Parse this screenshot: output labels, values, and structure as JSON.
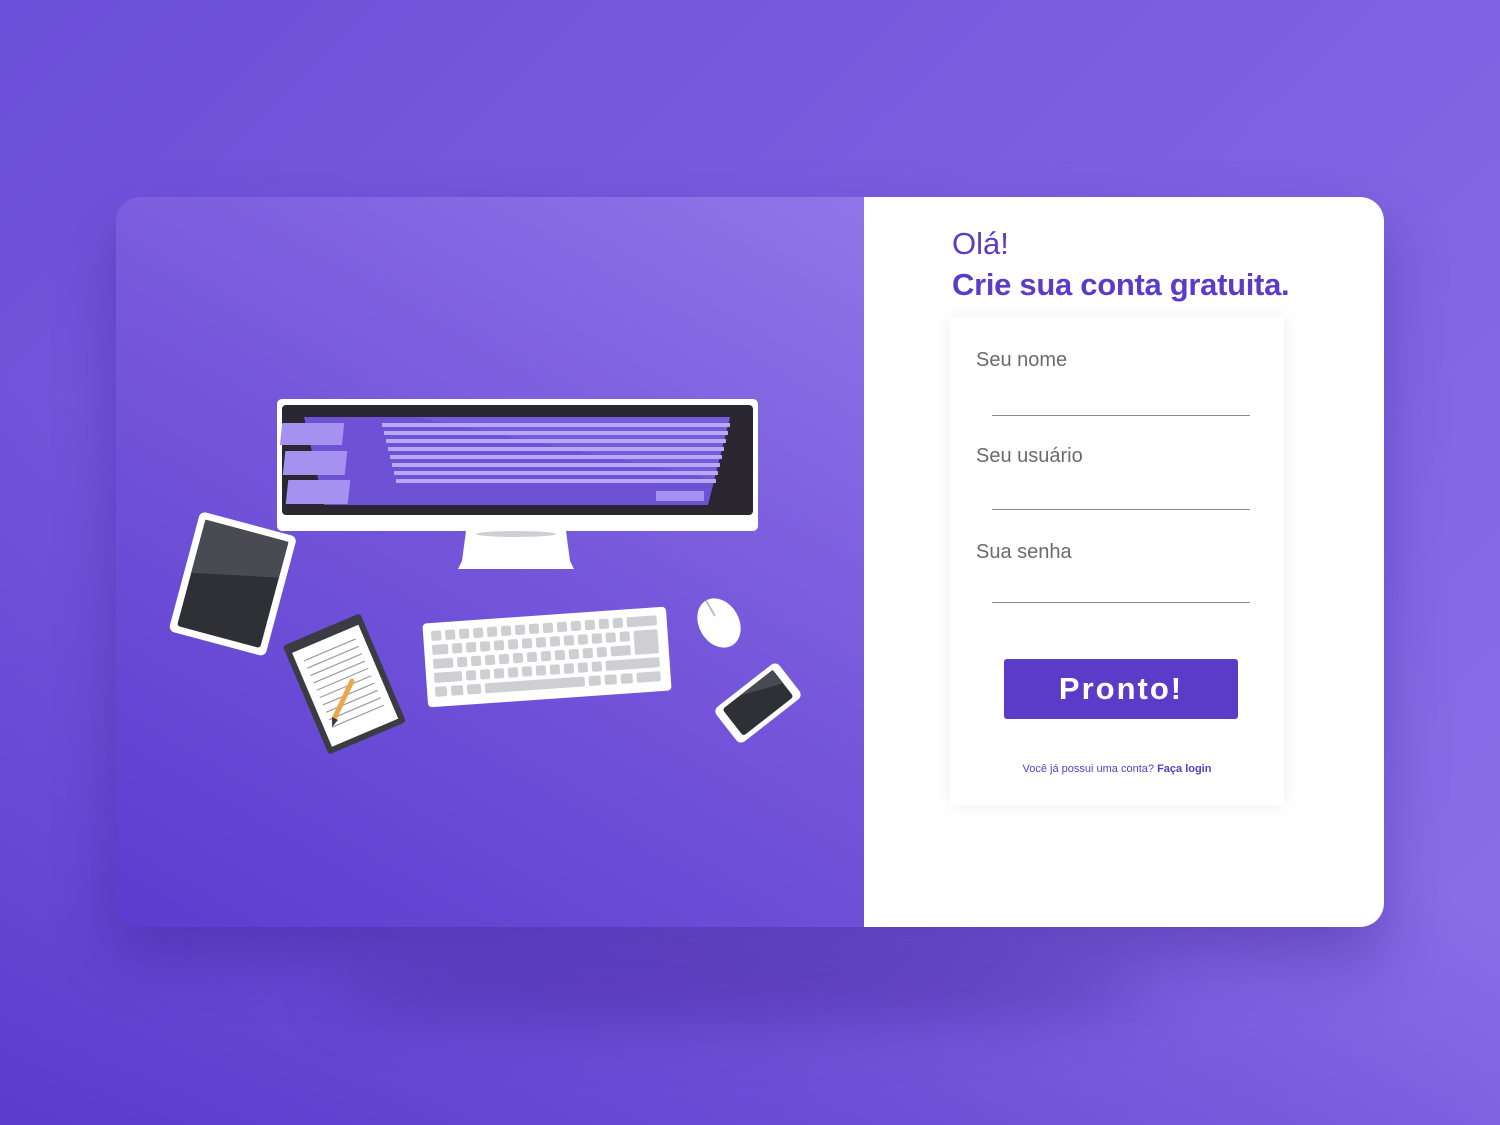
{
  "form": {
    "greeting": "Olá!",
    "headline": "Crie sua conta gratuita.",
    "fields": [
      {
        "label": "Seu nome",
        "value": "",
        "placeholder": ""
      },
      {
        "label": "Seu usuário",
        "value": "",
        "placeholder": ""
      },
      {
        "label": "Sua senha",
        "value": "",
        "placeholder": ""
      }
    ],
    "submit_label": "Pronto!",
    "login_prompt": "Você já possui uma conta?",
    "login_link": "Faça login"
  },
  "illustration": {
    "items": [
      "monitor-icon",
      "tablet-icon",
      "notepad-icon",
      "pencil-icon",
      "keyboard-icon",
      "mouse-icon",
      "smartphone-icon"
    ]
  },
  "colors": {
    "accent": "#5a3cc8",
    "background": "#7b5fe0",
    "panel": "#ffffff"
  }
}
